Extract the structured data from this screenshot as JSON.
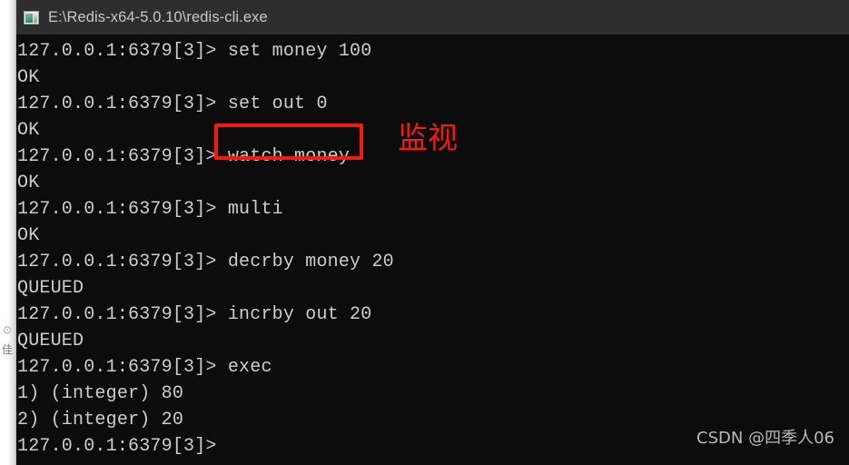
{
  "window": {
    "title": "E:\\Redis-x64-5.0.10\\redis-cli.exe",
    "icon": "console-window-icon",
    "background_color": "#0c0c0c",
    "titlebar_color": "#2e2e2e",
    "text_color": "#cccccc"
  },
  "terminal": {
    "prompt": "127.0.0.1:6379[3]>",
    "lines": [
      "127.0.0.1:6379[3]> set money 100",
      "OK",
      "127.0.0.1:6379[3]> set out 0",
      "OK",
      "127.0.0.1:6379[3]> watch money",
      "OK",
      "127.0.0.1:6379[3]> multi",
      "OK",
      "127.0.0.1:6379[3]> decrby money 20",
      "QUEUED",
      "127.0.0.1:6379[3]> incrby out 20",
      "QUEUED",
      "127.0.0.1:6379[3]> exec",
      "1) (integer) 80",
      "2) (integer) 20",
      "127.0.0.1:6379[3]>"
    ]
  },
  "annotation": {
    "highlight_command": "watch money",
    "label": "监视",
    "color": "#f41a10"
  },
  "watermark": {
    "text": "CSDN @四季人06",
    "color": "#b9b9b9"
  },
  "background_app": {
    "gear_glyph": "⚙",
    "cjk_glyph": "佳"
  }
}
